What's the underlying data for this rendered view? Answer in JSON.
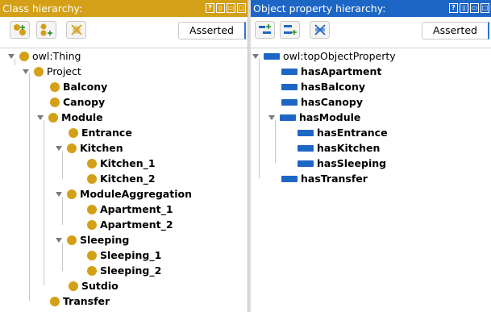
{
  "left_panel": {
    "title": "Class hierarchy:",
    "window_buttons": [
      "?",
      "▯",
      "▭",
      "□"
    ],
    "mode": "Asserted",
    "nodes": [
      {
        "label": "owl:Thing",
        "bold": false,
        "expanded": true
      },
      {
        "label": "Project",
        "bold": false,
        "expanded": true
      },
      {
        "label": "Balcony",
        "bold": true
      },
      {
        "label": "Canopy",
        "bold": true
      },
      {
        "label": "Module",
        "bold": true,
        "expanded": true
      },
      {
        "label": "Entrance",
        "bold": true
      },
      {
        "label": "Kitchen",
        "bold": true,
        "expanded": true
      },
      {
        "label": "Kitchen_1",
        "bold": true
      },
      {
        "label": "Kitchen_2",
        "bold": true
      },
      {
        "label": "ModuleAggregation",
        "bold": true,
        "expanded": true
      },
      {
        "label": "Apartment_1",
        "bold": true
      },
      {
        "label": "Apartment_2",
        "bold": true
      },
      {
        "label": "Sleeping",
        "bold": true,
        "expanded": true
      },
      {
        "label": "Sleeping_1",
        "bold": true
      },
      {
        "label": "Sleeping_2",
        "bold": true
      },
      {
        "label": "Sutdio",
        "bold": true
      },
      {
        "label": "Transfer",
        "bold": true
      }
    ]
  },
  "right_panel": {
    "title": "Object property hierarchy:",
    "window_buttons": [
      "?",
      "▯",
      "▭",
      "□"
    ],
    "mode": "Asserted",
    "nodes": [
      {
        "label": "owl:topObjectProperty",
        "bold": false,
        "expanded": true
      },
      {
        "label": "hasApartment",
        "bold": true
      },
      {
        "label": "hasBalcony",
        "bold": true
      },
      {
        "label": "hasCanopy",
        "bold": true
      },
      {
        "label": "hasModule",
        "bold": true,
        "expanded": true
      },
      {
        "label": "hasEntrance",
        "bold": true
      },
      {
        "label": "hasKitchen",
        "bold": true
      },
      {
        "label": "hasSleeping",
        "bold": true
      },
      {
        "label": "hasTransfer",
        "bold": true
      }
    ]
  },
  "colors": {
    "class_accent": "#d4a017",
    "property_accent": "#1e66c5"
  }
}
